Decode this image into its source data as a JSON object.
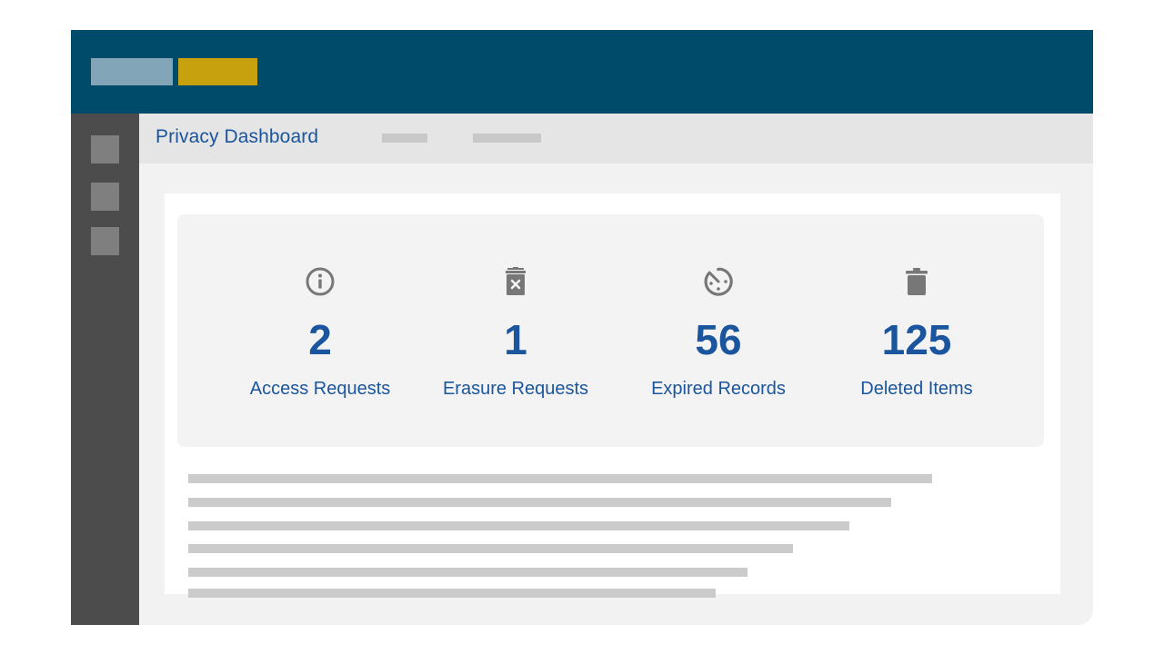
{
  "app": {
    "header": {
      "logo_primary_color": "#82a5b7",
      "logo_accent_color": "#c7a20e",
      "background_color": "#004a6a"
    },
    "sidebar": {
      "items": [
        {
          "name": "nav-item-1"
        },
        {
          "name": "nav-item-2"
        },
        {
          "name": "nav-item-3"
        }
      ]
    },
    "subheader": {
      "title": "Privacy Dashboard",
      "tabs": [
        {
          "label": ""
        },
        {
          "label": ""
        }
      ]
    }
  },
  "stats": [
    {
      "icon": "info-icon",
      "value": "2",
      "label": "Access Requests"
    },
    {
      "icon": "trash-x-icon",
      "value": "1",
      "label": "Erasure Requests"
    },
    {
      "icon": "timer-off-icon",
      "value": "56",
      "label": "Expired Records"
    },
    {
      "icon": "trash-icon",
      "value": "125",
      "label": "Deleted Items"
    }
  ],
  "colors": {
    "accent_text": "#1a559d",
    "icon_gray": "#777777"
  }
}
